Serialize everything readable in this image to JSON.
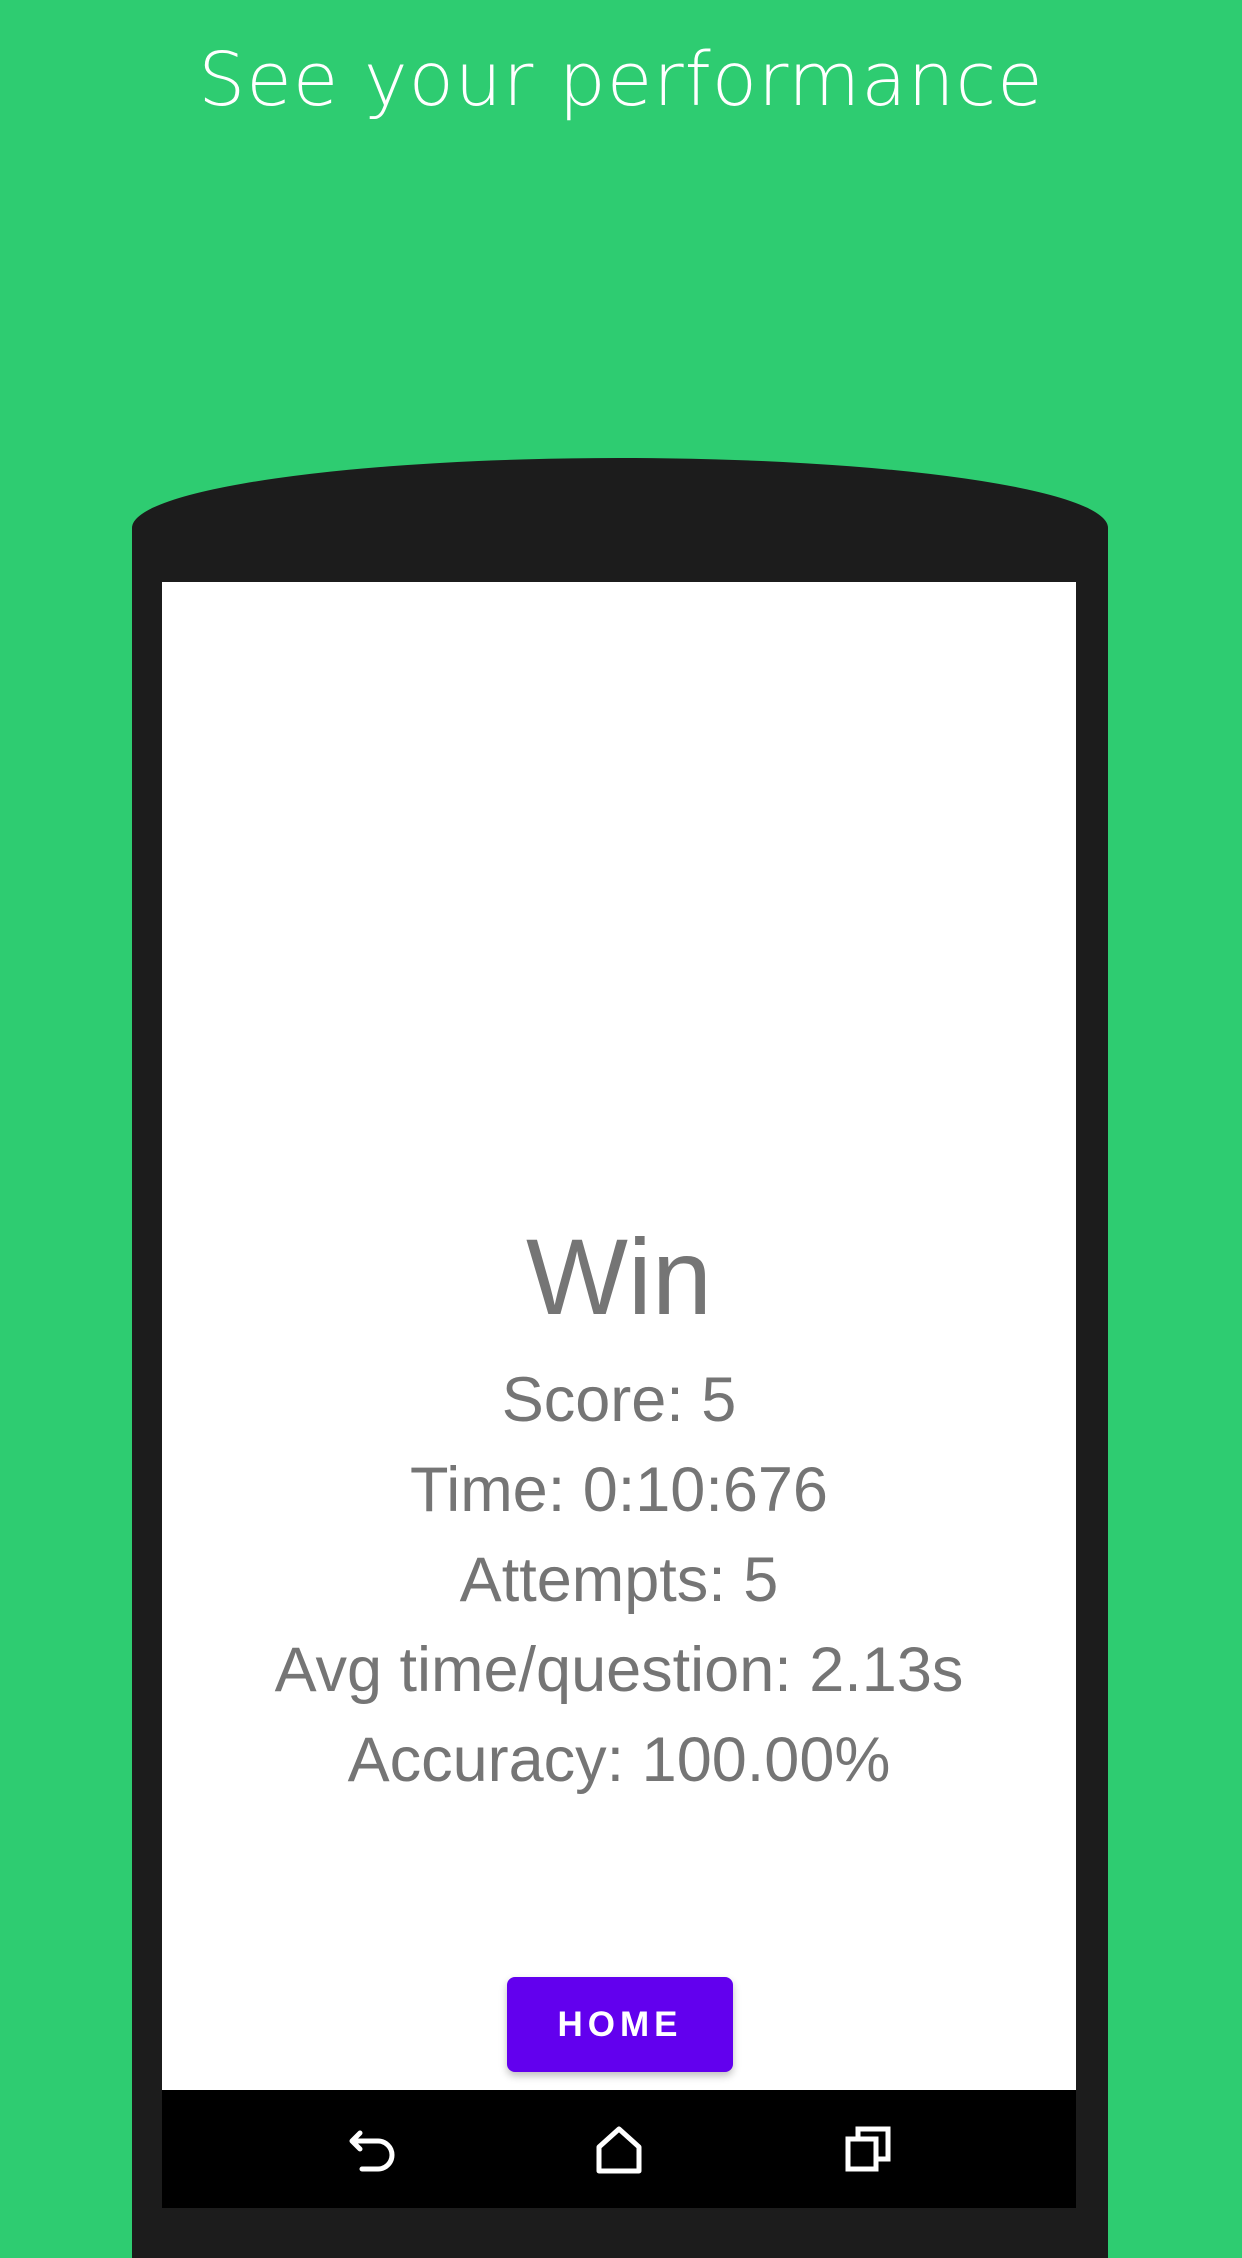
{
  "header": {
    "caption": "See your performance"
  },
  "result": {
    "title": "Win",
    "stats": [
      "Score: 5",
      "Time: 0:10:676",
      "Attempts: 5",
      "Avg time/question: 2.13s",
      "Accuracy: 100.00%"
    ]
  },
  "actions": {
    "home_label": "HOME"
  },
  "navbar": {
    "icons": [
      "back-icon",
      "home-icon",
      "recent-apps-icon"
    ]
  },
  "colors": {
    "background": "#2ecc71",
    "phone_frame": "#1c1c1c",
    "text_gray": "#757575",
    "button_accent": "#6200ee",
    "navbar": "#000000"
  }
}
